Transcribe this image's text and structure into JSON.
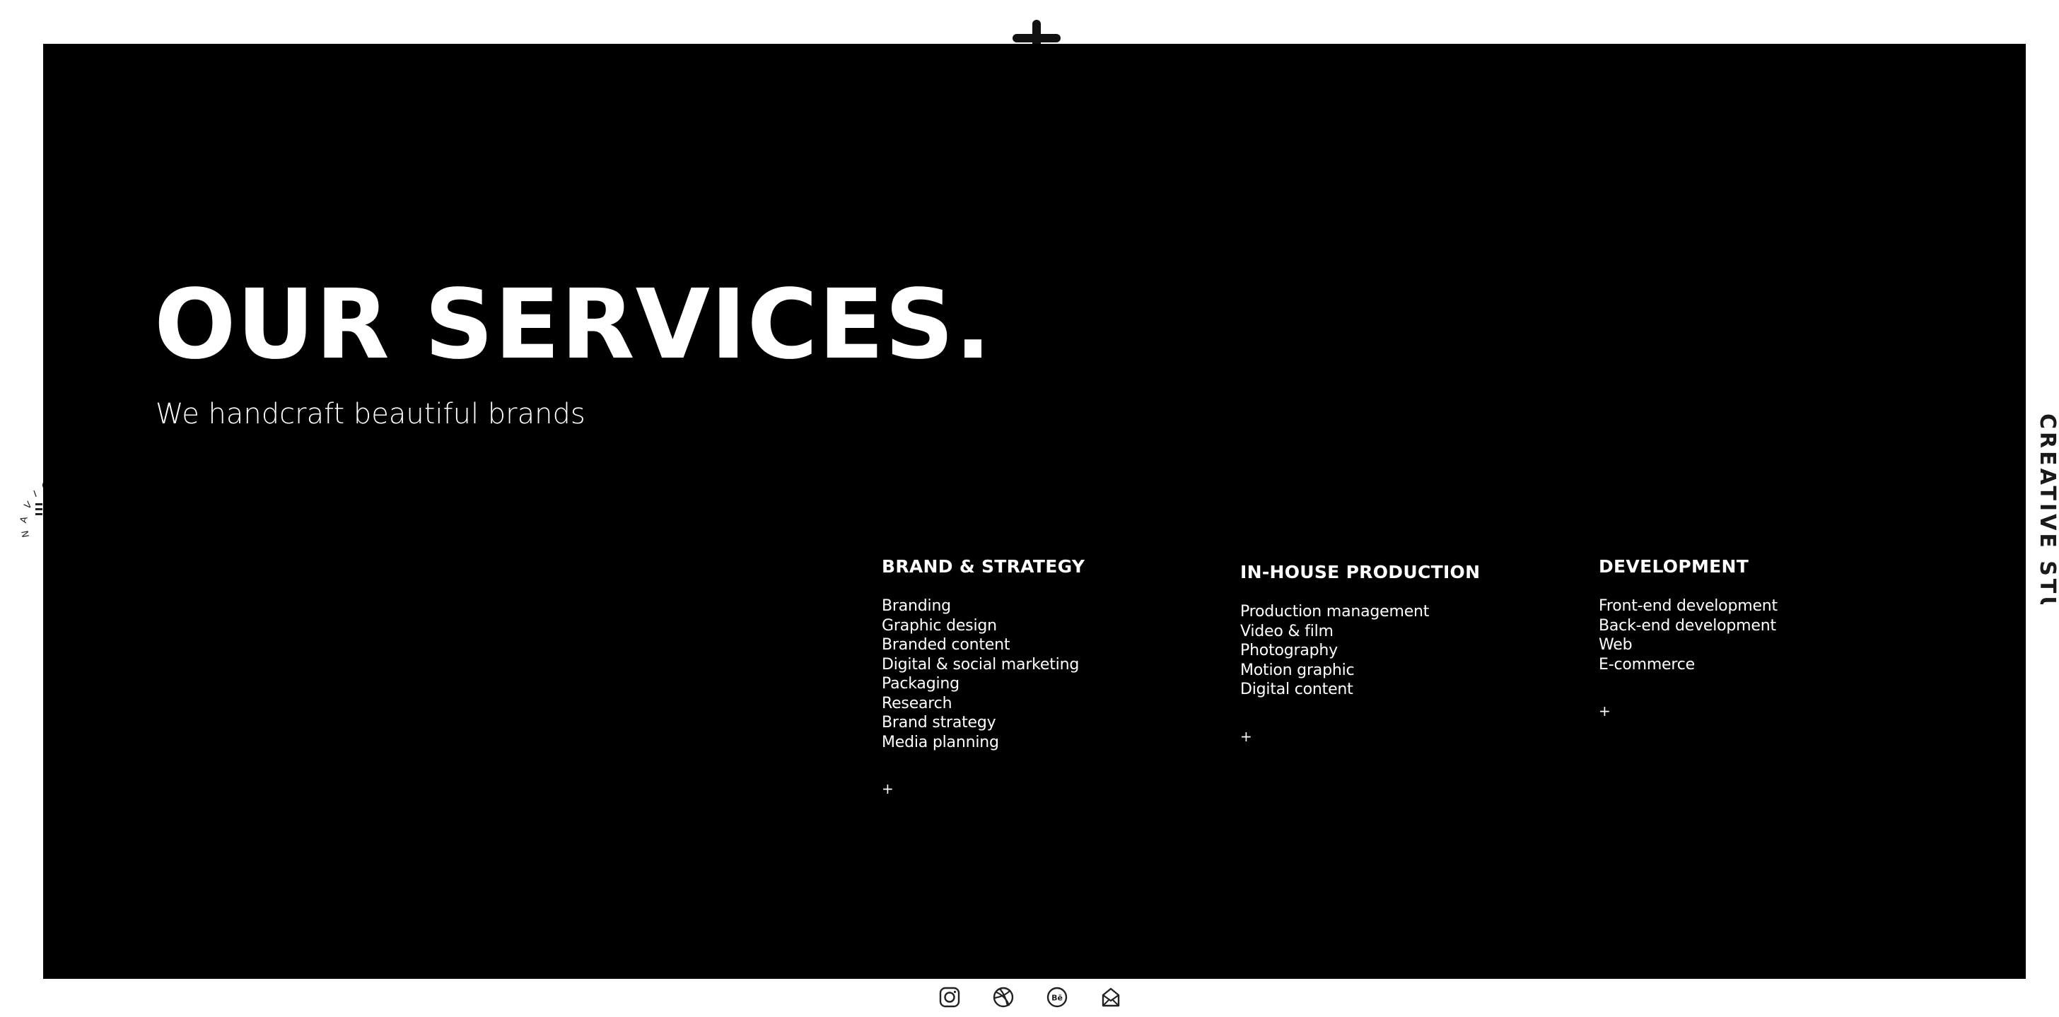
{
  "hero": {
    "title": "OUR SERVICES.",
    "subtitle": "We handcraft beautiful brands"
  },
  "services": [
    {
      "title": "BRAND & STRATEGY",
      "items": [
        "Branding",
        "Graphic design",
        "Branded content",
        "Digital & social marketing",
        "Packaging",
        "Research",
        "Brand strategy",
        "Media planning"
      ],
      "more": "+"
    },
    {
      "title": "IN-HOUSE PRODUCTION",
      "items": [
        "Production management",
        "Video & film",
        "Photography",
        "Motion graphic",
        "Digital content"
      ],
      "more": "+"
    },
    {
      "title": "DEVELOPMENT",
      "items": [
        "Front-end development",
        "Back-end development",
        "Web",
        "E-commerce"
      ],
      "more": "+"
    }
  ],
  "nav": {
    "letters": [
      "N",
      "A",
      "V",
      "I",
      "G"
    ]
  },
  "side": {
    "text": "CREATIVE STUDIO"
  },
  "social": {
    "icons": [
      "instagram-icon",
      "dribbble-icon",
      "behance-icon",
      "mail-icon"
    ],
    "behance_label": "Bē"
  }
}
